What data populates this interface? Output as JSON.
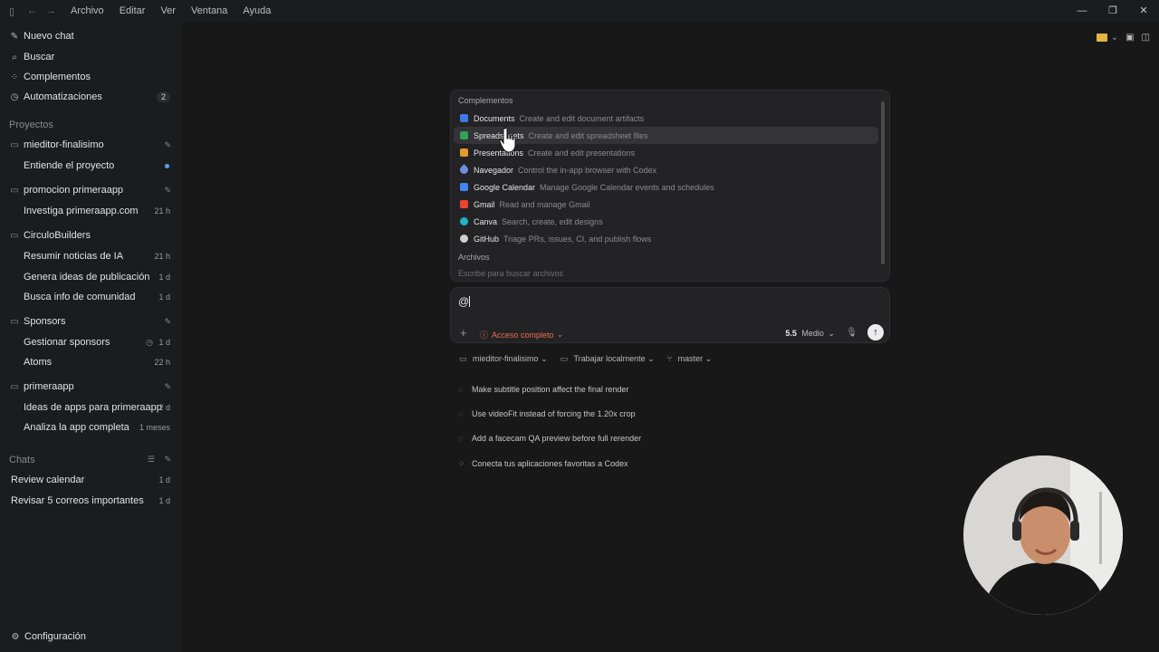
{
  "menu": [
    "Archivo",
    "Editar",
    "Ver",
    "Ventana",
    "Ayuda"
  ],
  "sidebar": {
    "top": [
      {
        "label": "Nuevo chat",
        "icon": "edit-icon"
      },
      {
        "label": "Buscar",
        "icon": "search-icon"
      },
      {
        "label": "Complementos",
        "icon": "grid-icon"
      },
      {
        "label": "Automatizaciones",
        "icon": "clock-icon",
        "badge": "2"
      }
    ],
    "projects_title": "Proyectos",
    "projects": [
      {
        "name": "mieditor-finalisimo",
        "items": [
          {
            "label": "Entiende el proyecto",
            "meta": ""
          }
        ]
      },
      {
        "name": "promocion primeraapp",
        "items": [
          {
            "label": "Investiga primeraapp.com",
            "meta": "21 h"
          }
        ]
      },
      {
        "name": "CirculoBuilders",
        "items": [
          {
            "label": "Resumir noticias de IA",
            "meta": "21 h"
          },
          {
            "label": "Genera ideas de publicación",
            "meta": "1 d"
          },
          {
            "label": "Busca info de comunidad",
            "meta": "1 d"
          }
        ]
      },
      {
        "name": "Sponsors",
        "items": [
          {
            "label": "Gestionar sponsors",
            "meta": "1 d"
          },
          {
            "label": "Atoms",
            "meta": "22 h"
          }
        ]
      },
      {
        "name": "primeraapp",
        "items": [
          {
            "label": "Ideas de apps para primeraapp",
            "meta": "2 d"
          },
          {
            "label": "Analiza la app completa",
            "meta": "1 meses"
          }
        ]
      }
    ],
    "chats_title": "Chats",
    "chats": [
      {
        "label": "Review calendar",
        "meta": "1 d"
      },
      {
        "label": "Revisar 5 correos importantes",
        "meta": "1 d"
      }
    ],
    "settings": "Configuración"
  },
  "popup": {
    "title": "Complementos",
    "items": [
      {
        "name": "Documents",
        "desc": "Create and edit document artifacts",
        "color": "#3b7be8"
      },
      {
        "name": "Spreadsheets",
        "desc": "Create and edit spreadsheet files",
        "color": "#2fa35a"
      },
      {
        "name": "Presentations",
        "desc": "Create and edit presentations",
        "color": "#e39a2b"
      },
      {
        "name": "Navegador",
        "desc": "Control the in-app browser with Codex",
        "color": "#6d8fd9"
      },
      {
        "name": "Google Calendar",
        "desc": "Manage Google Calendar events and schedules",
        "color": "#4285f4"
      },
      {
        "name": "Gmail",
        "desc": "Read and manage Gmail",
        "color": "#ea4335"
      },
      {
        "name": "Canva",
        "desc": "Search, create, edit designs",
        "color": "#1fb4c9"
      },
      {
        "name": "GitHub",
        "desc": "Triage PRs, issues, CI, and publish flows",
        "color": "#d0d0d0"
      }
    ],
    "files_title": "Archivos",
    "files_placeholder": "Escribe para buscar archivos"
  },
  "composer": {
    "text": "@",
    "access": "Acceso completo",
    "model": "5.5",
    "effort": "Medio"
  },
  "context": {
    "project": "mieditor-finalisimo",
    "mode": "Trabajar localmente",
    "branch": "master"
  },
  "suggestions": [
    "Make subtitle position affect the final render",
    "Use videoFit instead of forcing the 1.20x crop",
    "Add a facecam QA preview before full rerender",
    "Conecta tus aplicaciones favoritas a Codex"
  ]
}
